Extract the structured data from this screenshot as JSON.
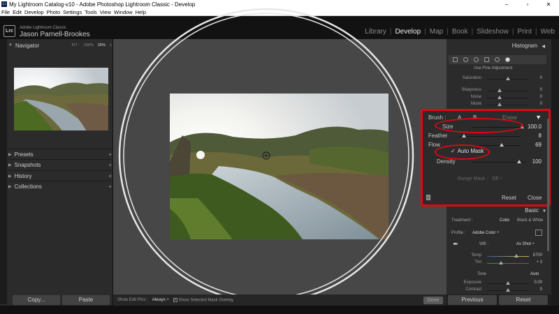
{
  "window": {
    "title": "My Lightroom Catalog-v10 - Adobe Photoshop Lightroom Classic - Develop",
    "minimize": "–",
    "maximize": "▫",
    "close": "✕"
  },
  "menu": [
    "File",
    "Edit",
    "Develop",
    "Photo",
    "Settings",
    "Tools",
    "View",
    "Window",
    "Help"
  ],
  "identity": {
    "logo": "Lrc",
    "product": "Adobe Lightroom Classic",
    "user": "Jason Parnell-Brookes"
  },
  "modules": [
    "Library",
    "Develop",
    "Map",
    "Book",
    "Slideshow",
    "Print",
    "Web"
  ],
  "active_module": "Develop",
  "left_panel": {
    "navigator": {
      "title": "Navigator",
      "zoom_options": [
        "FIT :",
        "100%",
        "25%",
        "‡"
      ]
    },
    "sections": [
      {
        "label": "Presets",
        "action": "+"
      },
      {
        "label": "Snapshots",
        "action": "+"
      },
      {
        "label": "History",
        "action": "×"
      },
      {
        "label": "Collections",
        "action": "+"
      }
    ],
    "copy_button": "Copy...",
    "paste_button": "Paste"
  },
  "toolbar": {
    "show_edit_pins_label": "Show Edit Pins :",
    "show_edit_pins_value": "Always ÷",
    "show_mask_overlay_label": "Show Selected Mask Overlay",
    "show_mask_overlay_checked": "✓",
    "done_button": "Done"
  },
  "right_panel": {
    "histogram_label": "Histogram",
    "fine_adjustment": "Use Fine Adjustment",
    "top_sliders": [
      {
        "label": "Saturation",
        "value": "0"
      },
      {
        "label": "Sharpness",
        "value": "0"
      },
      {
        "label": "Noise",
        "value": "0"
      },
      {
        "label": "Moiré",
        "value": "0"
      }
    ],
    "brush": {
      "label": "Brush :",
      "a_label": "A",
      "b_label": "B",
      "erase_label": "Erase",
      "sliders": [
        {
          "label": "Size",
          "value": "100.0",
          "level": 0.92
        },
        {
          "label": "Feather",
          "value": "8",
          "level": 0.08
        },
        {
          "label": "Flow",
          "value": "69",
          "level": 0.69
        }
      ],
      "auto_mask_label": "Auto Mask",
      "auto_mask_check": "✓",
      "density": {
        "label": "Density",
        "value": "100",
        "level": 1.0
      },
      "range_mask_label": "Range Mask :",
      "range_mask_value": "Off ÷",
      "reset_button": "Reset",
      "close_button": "Close"
    },
    "basic": {
      "label": "Basic",
      "treatment_label": "Treatment :",
      "treatment_color": "Color",
      "treatment_bw": "Black & White",
      "profile_label": "Profile :",
      "profile_value": "Adobe Color ÷",
      "wb_label": "WB :",
      "wb_value": "As Shot ÷",
      "temp_label": "Temp",
      "temp_value": "6700",
      "tint_label": "Tint",
      "tint_value": "+ 3",
      "tone_label": "Tone",
      "tone_auto": "Auto",
      "exposure_label": "Exposure",
      "exposure_value": "0.00",
      "contrast_label": "Contrast",
      "contrast_value": "0"
    },
    "previous_button": "Previous",
    "reset_button": "Reset"
  },
  "colors": {
    "highlight": "#e30613",
    "panel": "#2b2b2b",
    "canvas": "#474747"
  }
}
